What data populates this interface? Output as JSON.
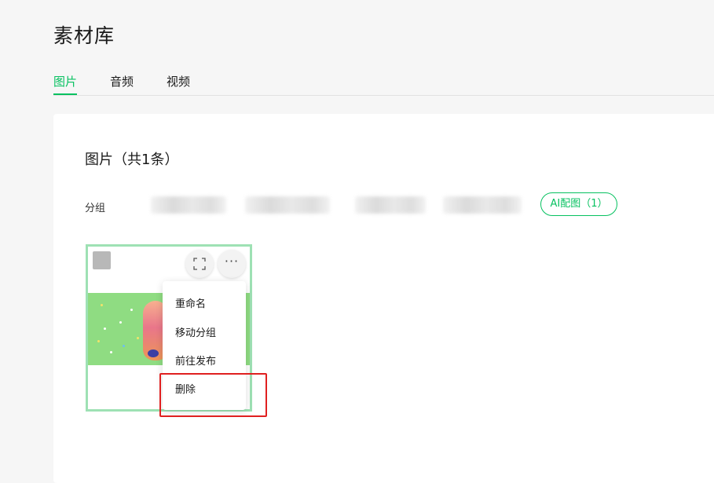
{
  "page": {
    "title": "素材库"
  },
  "tabs": [
    {
      "label": "图片"
    },
    {
      "label": "音频"
    },
    {
      "label": "视频"
    }
  ],
  "section": {
    "title": "图片（共1条）"
  },
  "groups": {
    "label": "分组",
    "ai_group": "AI配图（1）"
  },
  "menu": {
    "items": [
      {
        "label": "重命名"
      },
      {
        "label": "移动分组"
      },
      {
        "label": "前往发布"
      },
      {
        "label": "删除"
      }
    ]
  },
  "colors": {
    "accent": "#07c160",
    "highlight": "#e02020",
    "thumb_bg": "#8fdc82"
  },
  "icons": {
    "expand": "expand-icon",
    "more": "more-dots-icon"
  }
}
